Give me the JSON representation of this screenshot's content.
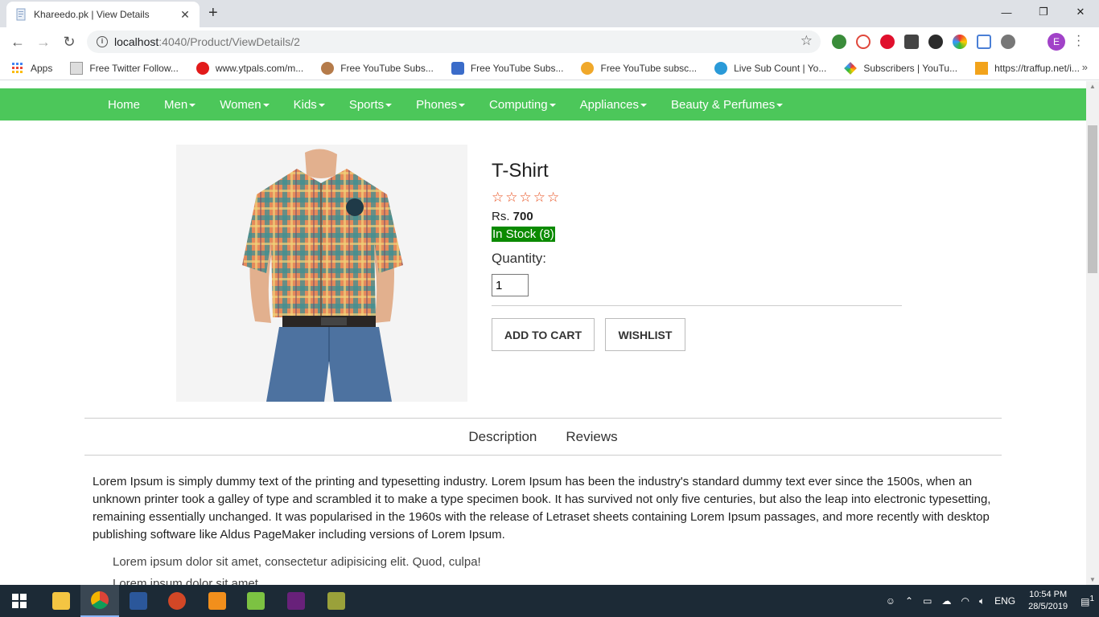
{
  "browser": {
    "tab_title": "Khareedo.pk | View Details",
    "url_host": "localhost",
    "url_path": ":4040/Product/ViewDetails/2",
    "profile_initial": "E",
    "bookmarks": [
      {
        "label": "Apps",
        "icon": "apps-grid-icon"
      },
      {
        "label": "Free Twitter Follow...",
        "icon": "twitter-icon"
      },
      {
        "label": "www.ytpals.com/m...",
        "icon": "ytpals-icon"
      },
      {
        "label": "Free YouTube Subs...",
        "icon": "youtube-icon"
      },
      {
        "label": "Free YouTube Subs...",
        "icon": "thumbs-up-icon"
      },
      {
        "label": "Free YouTube subsc...",
        "icon": "youtube-icon"
      },
      {
        "label": "Live Sub Count | Yo...",
        "icon": "sub-count-icon"
      },
      {
        "label": "Subscribers | YouTu...",
        "icon": "subscribers-icon"
      },
      {
        "label": "https://traffup.net/i...",
        "icon": "traffup-icon"
      }
    ]
  },
  "site_nav": {
    "items": [
      {
        "label": "Home",
        "dropdown": false
      },
      {
        "label": "Men",
        "dropdown": true
      },
      {
        "label": "Women",
        "dropdown": true
      },
      {
        "label": "Kids",
        "dropdown": true
      },
      {
        "label": "Sports",
        "dropdown": true
      },
      {
        "label": "Phones",
        "dropdown": true
      },
      {
        "label": "Computing",
        "dropdown": true
      },
      {
        "label": "Appliances",
        "dropdown": true
      },
      {
        "label": "Beauty & Perfumes",
        "dropdown": true
      }
    ],
    "color": "#4cc75a"
  },
  "product": {
    "title": "T-Shirt",
    "rating_stars": 5,
    "price_label": "Rs.",
    "price_value": "700",
    "stock": "In Stock (8)",
    "quantity_label": "Quantity:",
    "quantity_value": "1",
    "add_to_cart": "ADD TO CART",
    "wishlist": "WISHLIST"
  },
  "detail_tabs": {
    "description": "Description",
    "reviews": "Reviews"
  },
  "description": {
    "paragraph": "Lorem Ipsum is simply dummy text of the printing and typesetting industry. Lorem Ipsum has been the industry's standard dummy text ever since the 1500s, when an unknown printer took a galley of type and scrambled it to make a type specimen book. It has survived not only five centuries, but also the leap into electronic typesetting, remaining essentially unchanged. It was popularised in the 1960s with the release of Letraset sheets containing Lorem Ipsum passages, and more recently with desktop publishing software like Aldus PageMaker including versions of Lorem Ipsum.",
    "bullets": [
      "Lorem ipsum dolor sit amet, consectetur adipisicing elit. Quod, culpa!",
      "Lorem ipsum dolor sit amet."
    ]
  },
  "taskbar": {
    "language": "ENG",
    "time": "10:54 PM",
    "date": "28/5/2019",
    "notifications": "1"
  }
}
